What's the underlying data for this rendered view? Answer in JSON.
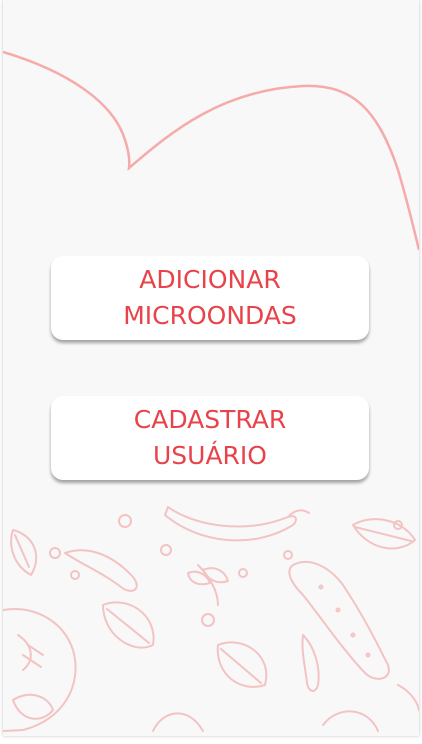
{
  "actions": {
    "add_microwave": {
      "line1": "ADICIONAR",
      "line2": "MICROONDAS"
    },
    "register_user": {
      "line1": "CADASTRAR",
      "line2": "USUÁRIO"
    }
  },
  "colors": {
    "accent": "#e8434a",
    "curve": "#f6aaaa",
    "pattern": "#f3c3c3",
    "background": "#f8f8f8"
  }
}
